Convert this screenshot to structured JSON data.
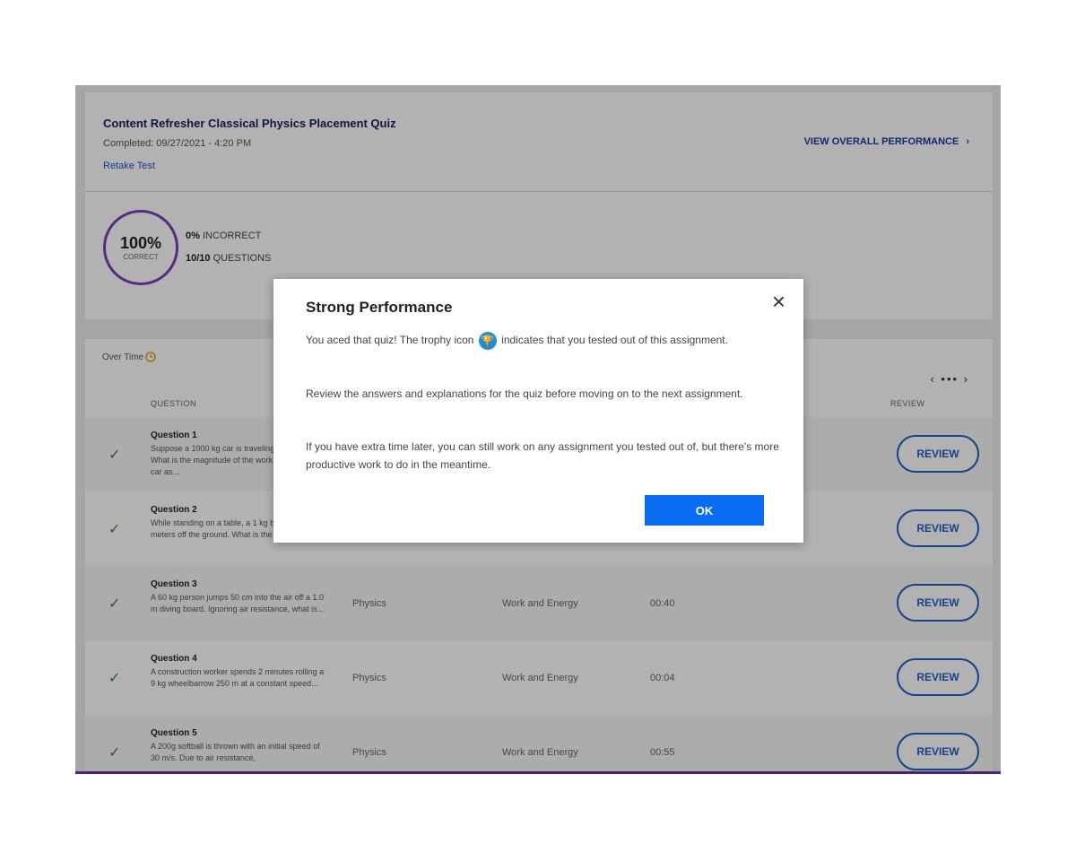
{
  "quiz": {
    "title": "Content Refresher Classical Physics Placement Quiz",
    "completed": "Completed: 09/27/2021 - 4:20 PM",
    "retake": "Retake Test",
    "view_overall": "VIEW OVERALL PERFORMANCE",
    "view_overall_chevron": "›"
  },
  "score": {
    "percent": "100%",
    "percent_label": "CORRECT",
    "incorrect_value": "0%",
    "incorrect_label": "INCORRECT",
    "questions_value": "10/10",
    "questions_label": "QUESTIONS"
  },
  "table": {
    "over_time": "Over Time",
    "pager": "‹ ••• ›",
    "headers": {
      "question": "QUESTION",
      "review": "REVIEW"
    },
    "rows": [
      {
        "title": "Question 1",
        "text": "Suppose a 1000 kg car is traveling at 20 m/s. What is the magnitude of the work done on the car as...",
        "subject": "",
        "topic": "",
        "time": "",
        "review": "REVIEW"
      },
      {
        "title": "Question 2",
        "text": "While standing on a table, a 1 kg ball is 1.2 meters off the ground. What is the gravitational...",
        "subject": "",
        "topic": "",
        "time": "",
        "review": "REVIEW"
      },
      {
        "title": "Question 3",
        "text": "A 60 kg person jumps 50 cm into the air off a 1.0 m diving board. Ignoring air resistance, what is...",
        "subject": "Physics",
        "topic": "Work and Energy",
        "time": "00:40",
        "review": "REVIEW"
      },
      {
        "title": "Question 4",
        "text": "A construction worker spends 2 minutes rolling a 9 kg wheelbarrow 250 m at a constant speed...",
        "subject": "Physics",
        "topic": "Work and Energy",
        "time": "00:04",
        "review": "REVIEW"
      },
      {
        "title": "Question 5",
        "text": "A 200g softball is thrown with an initial speed of 30 m/s. Due to air resistance,",
        "subject": "Physics",
        "topic": "Work and Energy",
        "time": "00:55",
        "review": "REVIEW"
      }
    ]
  },
  "modal": {
    "title": "Strong Performance",
    "close": "×",
    "p1_before": "You aced that quiz! The trophy icon",
    "p1_after": "indicates that you tested out of this assignment.",
    "p2": "Review the answers and explanations for the quiz before moving on to the next assignment.",
    "p3": "If you have extra time later, you can still work on any assignment you tested out of, but there's more productive work to do in the meantime.",
    "ok": "OK"
  },
  "colors": {
    "accent": "#0a6cf0",
    "ring": "#7a3fb8",
    "review": "#1f5fc4",
    "check": "#2e8a2e"
  }
}
